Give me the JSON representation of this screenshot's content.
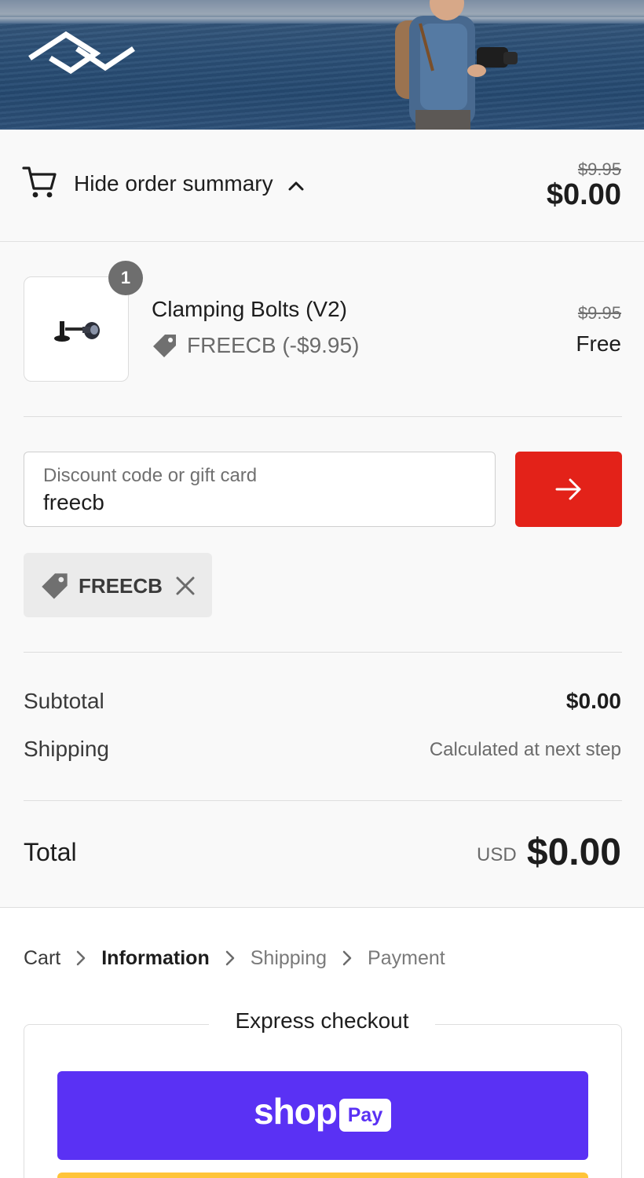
{
  "header": {
    "logo_icon": "peak-design-logo-icon",
    "banner_image": "ocean-photographer-image"
  },
  "summary_toggle": {
    "icon": "cart-icon",
    "label": "Hide order summary",
    "chevron_icon": "chevron-up-icon",
    "original_price": "$9.95",
    "total": "$0.00"
  },
  "line_items": [
    {
      "quantity": "1",
      "name": "Clamping Bolts (V2)",
      "discount_icon": "tag-icon",
      "discount": "FREECB (-$9.95)",
      "original_price": "$9.95",
      "price": "Free"
    }
  ],
  "discount_form": {
    "label": "Discount code or gift card",
    "value": "freecb",
    "apply_icon": "arrow-right-icon",
    "apply_color": "#e32219"
  },
  "applied_code": {
    "icon": "tag-icon",
    "code": "FREECB",
    "remove_icon": "close-icon"
  },
  "totals": {
    "subtotal_label": "Subtotal",
    "subtotal_value": "$0.00",
    "shipping_label": "Shipping",
    "shipping_value": "Calculated at next step",
    "total_label": "Total",
    "currency": "USD",
    "total_value": "$0.00"
  },
  "breadcrumb": {
    "items": [
      "Cart",
      "Information",
      "Shipping",
      "Payment"
    ],
    "active": "Information"
  },
  "express_checkout": {
    "title": "Express checkout",
    "shop_pay_word": "shop",
    "shop_pay_badge": "Pay",
    "shop_pay_color": "#5a31f4",
    "paypal_color": "#ffc439"
  }
}
